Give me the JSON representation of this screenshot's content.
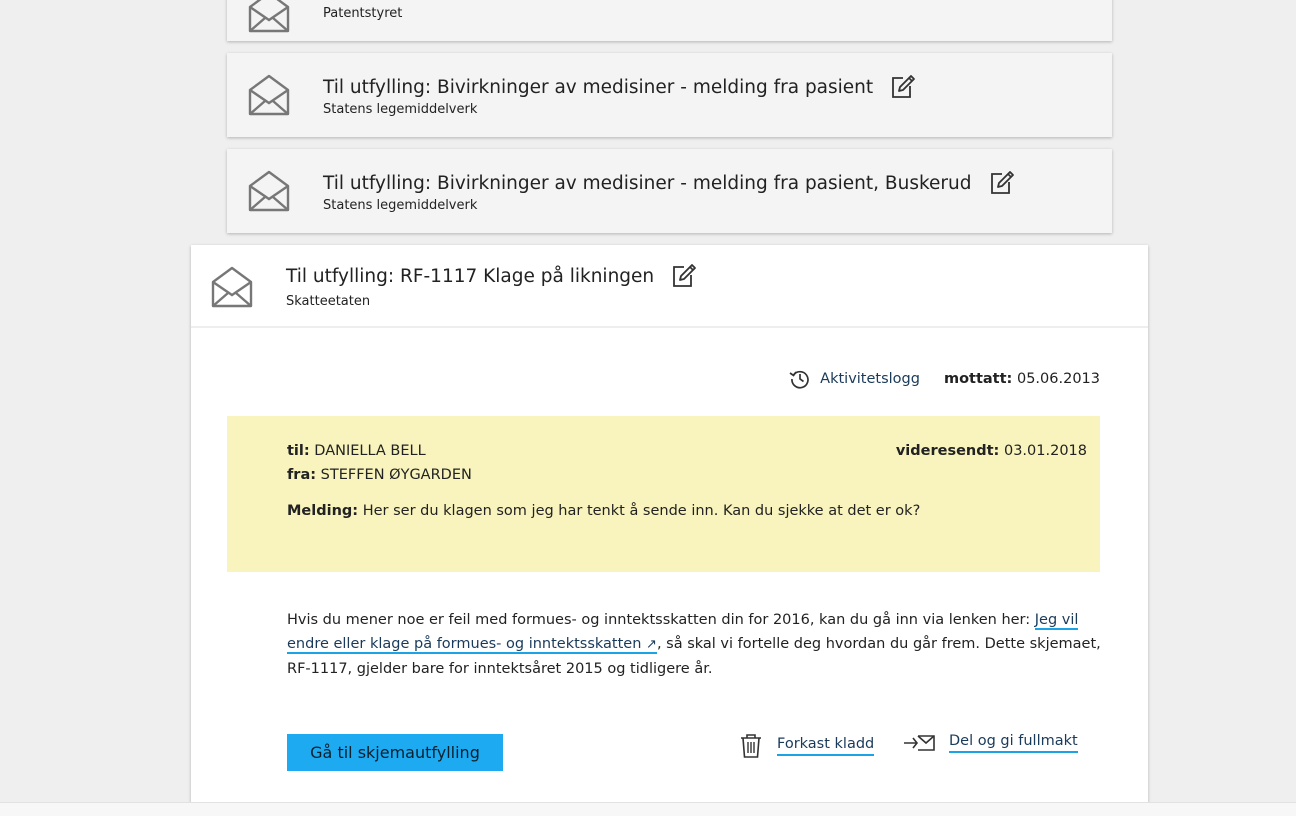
{
  "messages": [
    {
      "title": "",
      "sender": "Patentstyret"
    },
    {
      "title": "Til utfylling: Bivirkninger av medisiner - melding fra pasient",
      "sender": "Statens legemiddelverk"
    },
    {
      "title": "Til utfylling: Bivirkninger av medisiner - melding fra pasient, Buskerud",
      "sender": "Statens legemiddelverk"
    }
  ],
  "open_message": {
    "title": "Til utfylling: RF-1117 Klage på likningen",
    "sender": "Skatteetaten",
    "activity_log_label": "Aktivitetslogg",
    "received_label": "mottatt:",
    "received_date": "05.06.2013",
    "note": {
      "to_label": "til:",
      "to_value": "DANIELLA BELL",
      "from_label": "fra:",
      "from_value": "STEFFEN ØYGARDEN",
      "forwarded_label": "videresendt:",
      "forwarded_date": "03.01.2018",
      "message_label": "Melding:",
      "message_text": "Her ser du klagen som jeg har tenkt å sende inn. Kan du sjekke at det er ok?"
    },
    "body": {
      "text_before": "Hvis du mener noe er feil med formues- og inntektsskatten din for 2016, kan du gå inn via lenken her: ",
      "link_text": "Jeg vil endre eller klage på formues- og inntektsskatten",
      "text_after": ", så skal vi fortelle deg hvordan du går frem. Dette skjemaet, RF-1117,  gjelder bare for inntektsåret 2015 og tidligere år."
    },
    "primary_button": "Gå til skjemautfylling",
    "discard_label": "Forkast kladd",
    "share_label": "Del og gi fullmakt"
  },
  "colors": {
    "accent": "#1eaaf1",
    "note_bg": "#f9f4bd",
    "card_bg": "#f4f4f4",
    "page_bg": "#efefef"
  }
}
